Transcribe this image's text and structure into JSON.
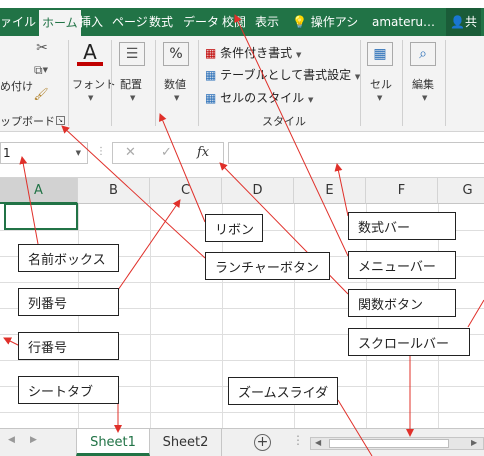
{
  "menu": {
    "tabs": [
      "ァイル",
      "ホーム",
      "挿入",
      "ページ",
      "数式",
      "データ",
      "校閲",
      "表示"
    ],
    "search_label": "操作アシ",
    "account": "amateru…",
    "share": "共"
  },
  "ribbon": {
    "paste_label": "め付け",
    "clipboard_label": "ップボード",
    "font_label": "フォント",
    "align_label": "配置",
    "number_label": "数値",
    "percent_symbol": "%",
    "font_icon_letter": "A",
    "style_items": [
      "条件付き書式",
      "テーブルとして書式設定",
      "セルのスタイル"
    ],
    "style_group": "スタイル",
    "cells_label": "セル",
    "edit_label": "編集"
  },
  "formula_bar": {
    "name_box": "1",
    "cancel": "✕",
    "enter": "✓",
    "fx": "fx"
  },
  "grid": {
    "columns": [
      "A",
      "B",
      "C",
      "D",
      "E",
      "F",
      "G"
    ]
  },
  "sheets": {
    "tabs": [
      "Sheet1",
      "Sheet2"
    ],
    "add": "+"
  },
  "callouts": {
    "name_box": "名前ボックス",
    "col_number": "列番号",
    "row_number": "行番号",
    "sheet_tab": "シートタブ",
    "ribbon": "リボン",
    "launcher": "ランチャーボタン",
    "formula_bar": "数式バー",
    "menu_bar": "メニューバー",
    "function_button": "関数ボタン",
    "scroll_bar": "スクロールバー",
    "zoom_slider": "ズームスライダ"
  },
  "colors": {
    "accent": "#217346",
    "arrow": "#e0302a"
  }
}
